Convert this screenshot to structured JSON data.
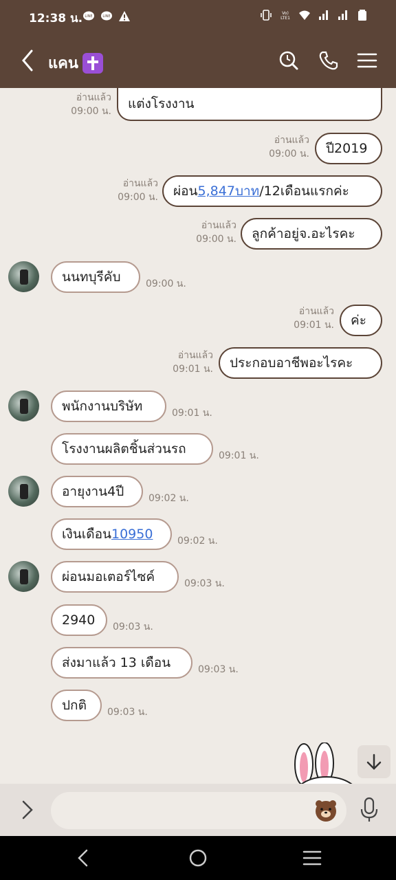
{
  "status": {
    "time": "12:38 น.",
    "icons": [
      "line-icon",
      "line-icon",
      "warning-icon",
      "vibrate-icon",
      "volte-icon",
      "wifi-icon",
      "signal-icon",
      "signal-icon",
      "battery-icon"
    ]
  },
  "header": {
    "title": "แคน"
  },
  "messages": [
    {
      "dir": "out",
      "text": "แต่งโรงงาน",
      "read": "อ่านแล้ว",
      "time": "09:00 น."
    },
    {
      "dir": "out",
      "text": "ปี2019",
      "read": "อ่านแล้ว",
      "time": "09:00 น."
    },
    {
      "dir": "out",
      "pre": "ผ่อน",
      "link": "5,847บาท",
      "post": "/12เดือนแรกค่ะ",
      "read": "อ่านแล้ว",
      "time": "09:00 น."
    },
    {
      "dir": "out",
      "text": "ลูกค้าอยู่จ.อะไรคะ",
      "read": "อ่านแล้ว",
      "time": "09:00 น."
    },
    {
      "dir": "in",
      "text": "นนทบุรีคับ",
      "time": "09:00 น."
    },
    {
      "dir": "out",
      "text": "ค่ะ",
      "read": "อ่านแล้ว",
      "time": "09:01 น."
    },
    {
      "dir": "out",
      "text": "ประกอบอาชีพอะไรคะ",
      "read": "อ่านแล้ว",
      "time": "09:01 น."
    },
    {
      "dir": "in",
      "text": "พนักงานบริษัท",
      "time": "09:01 น."
    },
    {
      "dir": "in",
      "text": "โรงงานผลิตชิ้นส่วนรถ",
      "time": "09:01 น."
    },
    {
      "dir": "in",
      "text": "อายุงาน4ปี",
      "time": "09:02 น."
    },
    {
      "dir": "in",
      "pre": "เงินเดือน",
      "link": "10950",
      "time": "09:02 น."
    },
    {
      "dir": "in",
      "text": "ผ่อนมอเตอร์ไซค์",
      "time": "09:03 น."
    },
    {
      "dir": "in",
      "text": "2940",
      "time": "09:03 น."
    },
    {
      "dir": "in",
      "text": "ส่งมาแล้ว 13 เดือน",
      "time": "09:03 น."
    },
    {
      "dir": "in",
      "text": "ปกติ",
      "time": "09:03 น."
    }
  ],
  "input": {
    "placeholder": ""
  }
}
